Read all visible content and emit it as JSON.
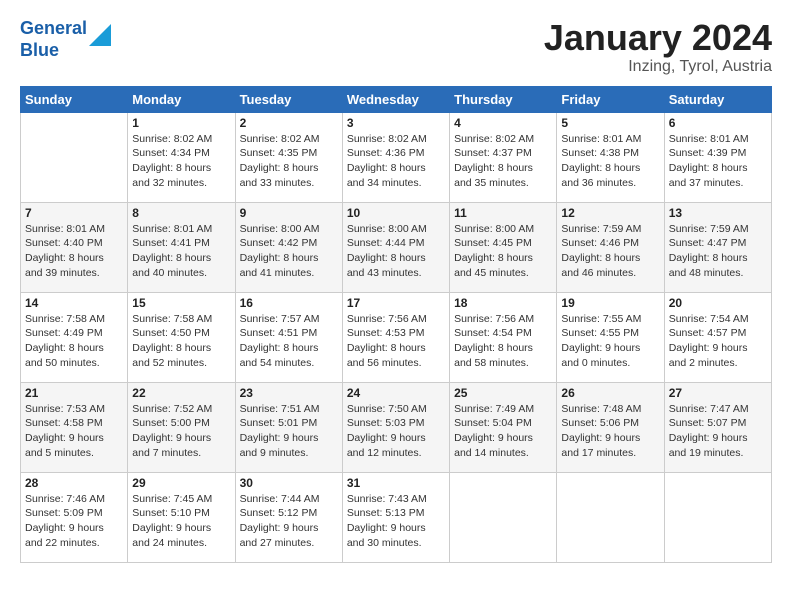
{
  "header": {
    "logo_line1": "General",
    "logo_line2": "Blue",
    "title": "January 2024",
    "subtitle": "Inzing, Tyrol, Austria"
  },
  "columns": [
    "Sunday",
    "Monday",
    "Tuesday",
    "Wednesday",
    "Thursday",
    "Friday",
    "Saturday"
  ],
  "weeks": [
    [
      {
        "day": "",
        "info": ""
      },
      {
        "day": "1",
        "info": "Sunrise: 8:02 AM\nSunset: 4:34 PM\nDaylight: 8 hours\nand 32 minutes."
      },
      {
        "day": "2",
        "info": "Sunrise: 8:02 AM\nSunset: 4:35 PM\nDaylight: 8 hours\nand 33 minutes."
      },
      {
        "day": "3",
        "info": "Sunrise: 8:02 AM\nSunset: 4:36 PM\nDaylight: 8 hours\nand 34 minutes."
      },
      {
        "day": "4",
        "info": "Sunrise: 8:02 AM\nSunset: 4:37 PM\nDaylight: 8 hours\nand 35 minutes."
      },
      {
        "day": "5",
        "info": "Sunrise: 8:01 AM\nSunset: 4:38 PM\nDaylight: 8 hours\nand 36 minutes."
      },
      {
        "day": "6",
        "info": "Sunrise: 8:01 AM\nSunset: 4:39 PM\nDaylight: 8 hours\nand 37 minutes."
      }
    ],
    [
      {
        "day": "7",
        "info": "Sunrise: 8:01 AM\nSunset: 4:40 PM\nDaylight: 8 hours\nand 39 minutes."
      },
      {
        "day": "8",
        "info": "Sunrise: 8:01 AM\nSunset: 4:41 PM\nDaylight: 8 hours\nand 40 minutes."
      },
      {
        "day": "9",
        "info": "Sunrise: 8:00 AM\nSunset: 4:42 PM\nDaylight: 8 hours\nand 41 minutes."
      },
      {
        "day": "10",
        "info": "Sunrise: 8:00 AM\nSunset: 4:44 PM\nDaylight: 8 hours\nand 43 minutes."
      },
      {
        "day": "11",
        "info": "Sunrise: 8:00 AM\nSunset: 4:45 PM\nDaylight: 8 hours\nand 45 minutes."
      },
      {
        "day": "12",
        "info": "Sunrise: 7:59 AM\nSunset: 4:46 PM\nDaylight: 8 hours\nand 46 minutes."
      },
      {
        "day": "13",
        "info": "Sunrise: 7:59 AM\nSunset: 4:47 PM\nDaylight: 8 hours\nand 48 minutes."
      }
    ],
    [
      {
        "day": "14",
        "info": "Sunrise: 7:58 AM\nSunset: 4:49 PM\nDaylight: 8 hours\nand 50 minutes."
      },
      {
        "day": "15",
        "info": "Sunrise: 7:58 AM\nSunset: 4:50 PM\nDaylight: 8 hours\nand 52 minutes."
      },
      {
        "day": "16",
        "info": "Sunrise: 7:57 AM\nSunset: 4:51 PM\nDaylight: 8 hours\nand 54 minutes."
      },
      {
        "day": "17",
        "info": "Sunrise: 7:56 AM\nSunset: 4:53 PM\nDaylight: 8 hours\nand 56 minutes."
      },
      {
        "day": "18",
        "info": "Sunrise: 7:56 AM\nSunset: 4:54 PM\nDaylight: 8 hours\nand 58 minutes."
      },
      {
        "day": "19",
        "info": "Sunrise: 7:55 AM\nSunset: 4:55 PM\nDaylight: 9 hours\nand 0 minutes."
      },
      {
        "day": "20",
        "info": "Sunrise: 7:54 AM\nSunset: 4:57 PM\nDaylight: 9 hours\nand 2 minutes."
      }
    ],
    [
      {
        "day": "21",
        "info": "Sunrise: 7:53 AM\nSunset: 4:58 PM\nDaylight: 9 hours\nand 5 minutes."
      },
      {
        "day": "22",
        "info": "Sunrise: 7:52 AM\nSunset: 5:00 PM\nDaylight: 9 hours\nand 7 minutes."
      },
      {
        "day": "23",
        "info": "Sunrise: 7:51 AM\nSunset: 5:01 PM\nDaylight: 9 hours\nand 9 minutes."
      },
      {
        "day": "24",
        "info": "Sunrise: 7:50 AM\nSunset: 5:03 PM\nDaylight: 9 hours\nand 12 minutes."
      },
      {
        "day": "25",
        "info": "Sunrise: 7:49 AM\nSunset: 5:04 PM\nDaylight: 9 hours\nand 14 minutes."
      },
      {
        "day": "26",
        "info": "Sunrise: 7:48 AM\nSunset: 5:06 PM\nDaylight: 9 hours\nand 17 minutes."
      },
      {
        "day": "27",
        "info": "Sunrise: 7:47 AM\nSunset: 5:07 PM\nDaylight: 9 hours\nand 19 minutes."
      }
    ],
    [
      {
        "day": "28",
        "info": "Sunrise: 7:46 AM\nSunset: 5:09 PM\nDaylight: 9 hours\nand 22 minutes."
      },
      {
        "day": "29",
        "info": "Sunrise: 7:45 AM\nSunset: 5:10 PM\nDaylight: 9 hours\nand 24 minutes."
      },
      {
        "day": "30",
        "info": "Sunrise: 7:44 AM\nSunset: 5:12 PM\nDaylight: 9 hours\nand 27 minutes."
      },
      {
        "day": "31",
        "info": "Sunrise: 7:43 AM\nSunset: 5:13 PM\nDaylight: 9 hours\nand 30 minutes."
      },
      {
        "day": "",
        "info": ""
      },
      {
        "day": "",
        "info": ""
      },
      {
        "day": "",
        "info": ""
      }
    ]
  ]
}
